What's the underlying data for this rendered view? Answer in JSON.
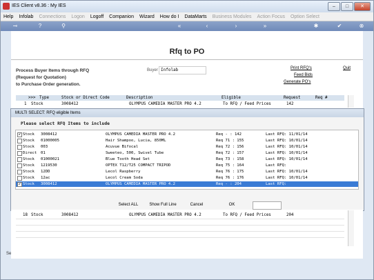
{
  "window": {
    "title": "IES Client v8.36 : My IES",
    "min": "–",
    "max": "□",
    "close": "✕"
  },
  "menu": [
    {
      "label": "Help",
      "disabled": false
    },
    {
      "label": "Infolab",
      "disabled": false
    },
    {
      "label": "Connections",
      "disabled": true
    },
    {
      "label": "Logon",
      "disabled": true
    },
    {
      "label": "Logoff",
      "disabled": false
    },
    {
      "label": "Companion",
      "disabled": false
    },
    {
      "label": "Wizard",
      "disabled": false
    },
    {
      "label": "How do I",
      "disabled": false
    },
    {
      "label": "DataMarts",
      "disabled": false
    },
    {
      "label": "Business Modules",
      "disabled": true
    },
    {
      "label": "Action Focus",
      "disabled": true
    },
    {
      "label": "Option Select",
      "disabled": true
    }
  ],
  "toolbar_icons": {
    "key": "⊸",
    "help": "?",
    "search": "⚲",
    "first": "«",
    "prev": "‹",
    "next": "›",
    "last": "»",
    "gear": "✱",
    "ok": "✔",
    "cancel": "⊗"
  },
  "page": {
    "title": "Rfq to PO"
  },
  "description": {
    "line1": "Process Buyer Items through RFQ",
    "line2": "(Request for Quotation)",
    "line3": "to Purchase Order generation."
  },
  "buyer": {
    "label": "Buyer",
    "value": "Infolab"
  },
  "links": {
    "print": "Print RFQ's",
    "feed": "Feed Bids",
    "generate": "Generate PO's",
    "quit": "Quit"
  },
  "grid": {
    "headers": {
      "marker": ">>>",
      "type": "Type",
      "stock": "Stock or Direct Code",
      "description": "Description",
      "eligible": "Eligible",
      "request": "Request",
      "req_no": "Req #"
    },
    "top_row": {
      "num": "1",
      "type": "Stock",
      "code": "3008412",
      "description": "OLYMPUS CAMEDIA MASTER PRO 4.2",
      "eligible": "To RFQ / Feed Prices",
      "request": "142"
    },
    "bottom_row": {
      "num": "18",
      "type": "Stock",
      "code": "3008412",
      "description": "OLYMPUS CAMEDIA MASTER PRO 4.2",
      "eligible": "To RFQ / Feed Prices",
      "request": "204"
    }
  },
  "dialog": {
    "title": "MULTI SELECT: RFQ eligible Items",
    "heading": "Please select RFQ Items to include",
    "rows": [
      {
        "checked": true,
        "type": "Stock",
        "code": "3008412",
        "description": "OLYMPUS CAMEDIA MASTER PRO 4.2",
        "req": "Req - : 142",
        "last": "Last RFQ: 11/01/14",
        "selected": false
      },
      {
        "checked": false,
        "type": "Stock",
        "code": "01000005",
        "description": "Hair Shampoo, Lucia, 850ML",
        "req": "Req 71 : 155",
        "last": "Last RFQ: 10/01/14",
        "selected": false
      },
      {
        "checked": false,
        "type": "Stock",
        "code": "003",
        "description": "Acuvue Bifocal",
        "req": "Req 72 : 156",
        "last": "Last RFQ: 10/01/14",
        "selected": false
      },
      {
        "checked": false,
        "type": "Direct",
        "code": "01",
        "description": "Sweeteo, 500, Swivel Tube",
        "req": "Req 72 : 157",
        "last": "Last RFQ: 10/01/14",
        "selected": false
      },
      {
        "checked": false,
        "type": "Stock",
        "code": "01000021",
        "description": "Blue Tooth Head Set",
        "req": "Req 73 : 158",
        "last": "Last RFQ: 10/01/14",
        "selected": false
      },
      {
        "checked": false,
        "type": "Stock",
        "code": "1219530",
        "description": "OPTEX T12/T25 COMPACT TRIPOD",
        "req": "Req 75 : 164",
        "last": "Last RFQ:",
        "selected": false
      },
      {
        "checked": false,
        "type": "Stock",
        "code": "12DD",
        "description": "Lecol Raspberry",
        "req": "Req 76 : 175",
        "last": "Last RFQ: 10/01/14",
        "selected": false
      },
      {
        "checked": false,
        "type": "Stock",
        "code": "12ac",
        "description": "Lecol Cream Soda",
        "req": "Req 76 : 176",
        "last": "Last RFQ: 10/01/14",
        "selected": false
      },
      {
        "checked": true,
        "type": "Stock",
        "code": "3008412",
        "description": "OLYMPUS CAMEDIA MASTER PRO 4.2",
        "req": "Req - : 204",
        "last": "Last RFQ:",
        "selected": true
      }
    ],
    "buttons": {
      "select_all": "Select ALL",
      "show_full_line": "Show Full Line",
      "cancel": "Cancel",
      "ok": "OK"
    }
  },
  "side": {
    "text": "Se"
  }
}
